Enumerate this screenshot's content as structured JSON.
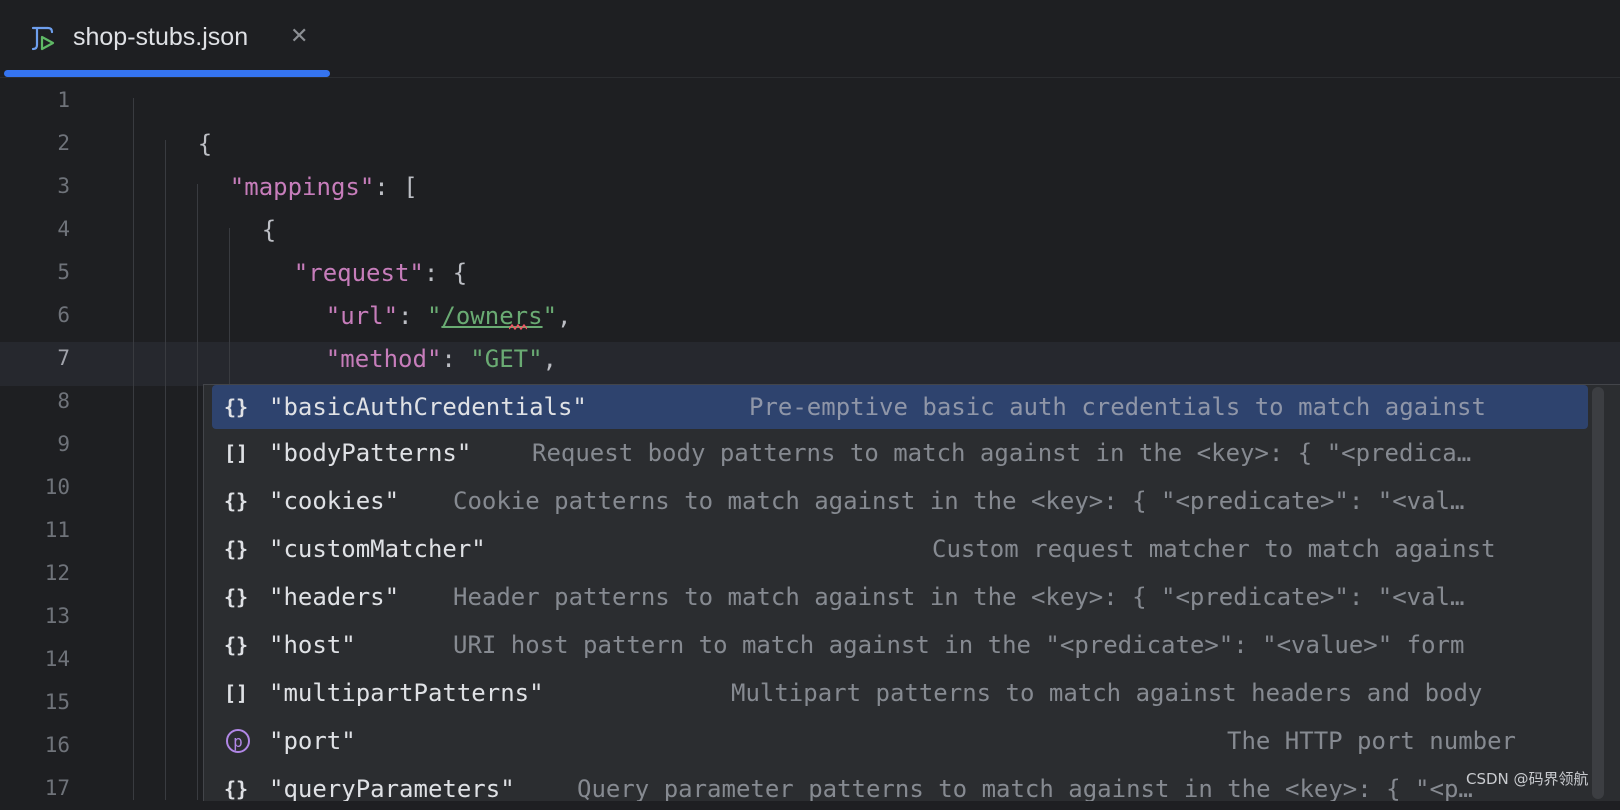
{
  "tab": {
    "title": "shop-stubs.json",
    "close_glyph": "✕",
    "icon": "json-file-icon",
    "accent": "#3574f0"
  },
  "gutter": [
    "1",
    "2",
    "3",
    "4",
    "5",
    "6",
    "7",
    "8",
    "9",
    "10",
    "11",
    "12",
    "13",
    "14",
    "15",
    "16",
    "17"
  ],
  "code": {
    "line1": "{",
    "line2_key": "\"mappings\"",
    "line2_rest": ": [",
    "line3": "{",
    "line4_key": "\"request\"",
    "line4_rest": ": {",
    "line5_key": "\"url\"",
    "line5_colon": ": ",
    "line5_q1": "\"",
    "line5_val": "/owners",
    "line5_q2": "\"",
    "line5_end": ",",
    "line6_key": "\"method\"",
    "line6_colon": ": ",
    "line6_val": "\"GET\"",
    "line6_end": ","
  },
  "completion": {
    "items": [
      {
        "icon": "{}",
        "name": "\"basicAuthCredentials\"",
        "desc": "Pre-emptive basic auth credentials to match against"
      },
      {
        "icon": "[]",
        "name": "\"bodyPatterns\"",
        "desc": "Request body patterns to match against in the <key>: { \"<predica…"
      },
      {
        "icon": "{}",
        "name": "\"cookies\"",
        "desc": "Cookie patterns to match against in the <key>: { \"<predicate>\": \"<val…"
      },
      {
        "icon": "{}",
        "name": "\"customMatcher\"",
        "desc": "Custom request matcher to match against"
      },
      {
        "icon": "{}",
        "name": "\"headers\"",
        "desc": "Header patterns to match against in the <key>: { \"<predicate>\": \"<val…"
      },
      {
        "icon": "{}",
        "name": "\"host\"",
        "desc": "URI host pattern to match against in the \"<predicate>\": \"<value>\" form"
      },
      {
        "icon": "[]",
        "name": "\"multipartPatterns\"",
        "desc": "Multipart patterns to match against headers and body"
      },
      {
        "icon": "p",
        "name": "\"port\"",
        "desc": "The HTTP port number"
      },
      {
        "icon": "{}",
        "name": "\"queryParameters\"",
        "desc": "Query parameter patterns to match against in the <key>: { \"<p…"
      }
    ]
  },
  "watermark": "CSDN @码界领航"
}
